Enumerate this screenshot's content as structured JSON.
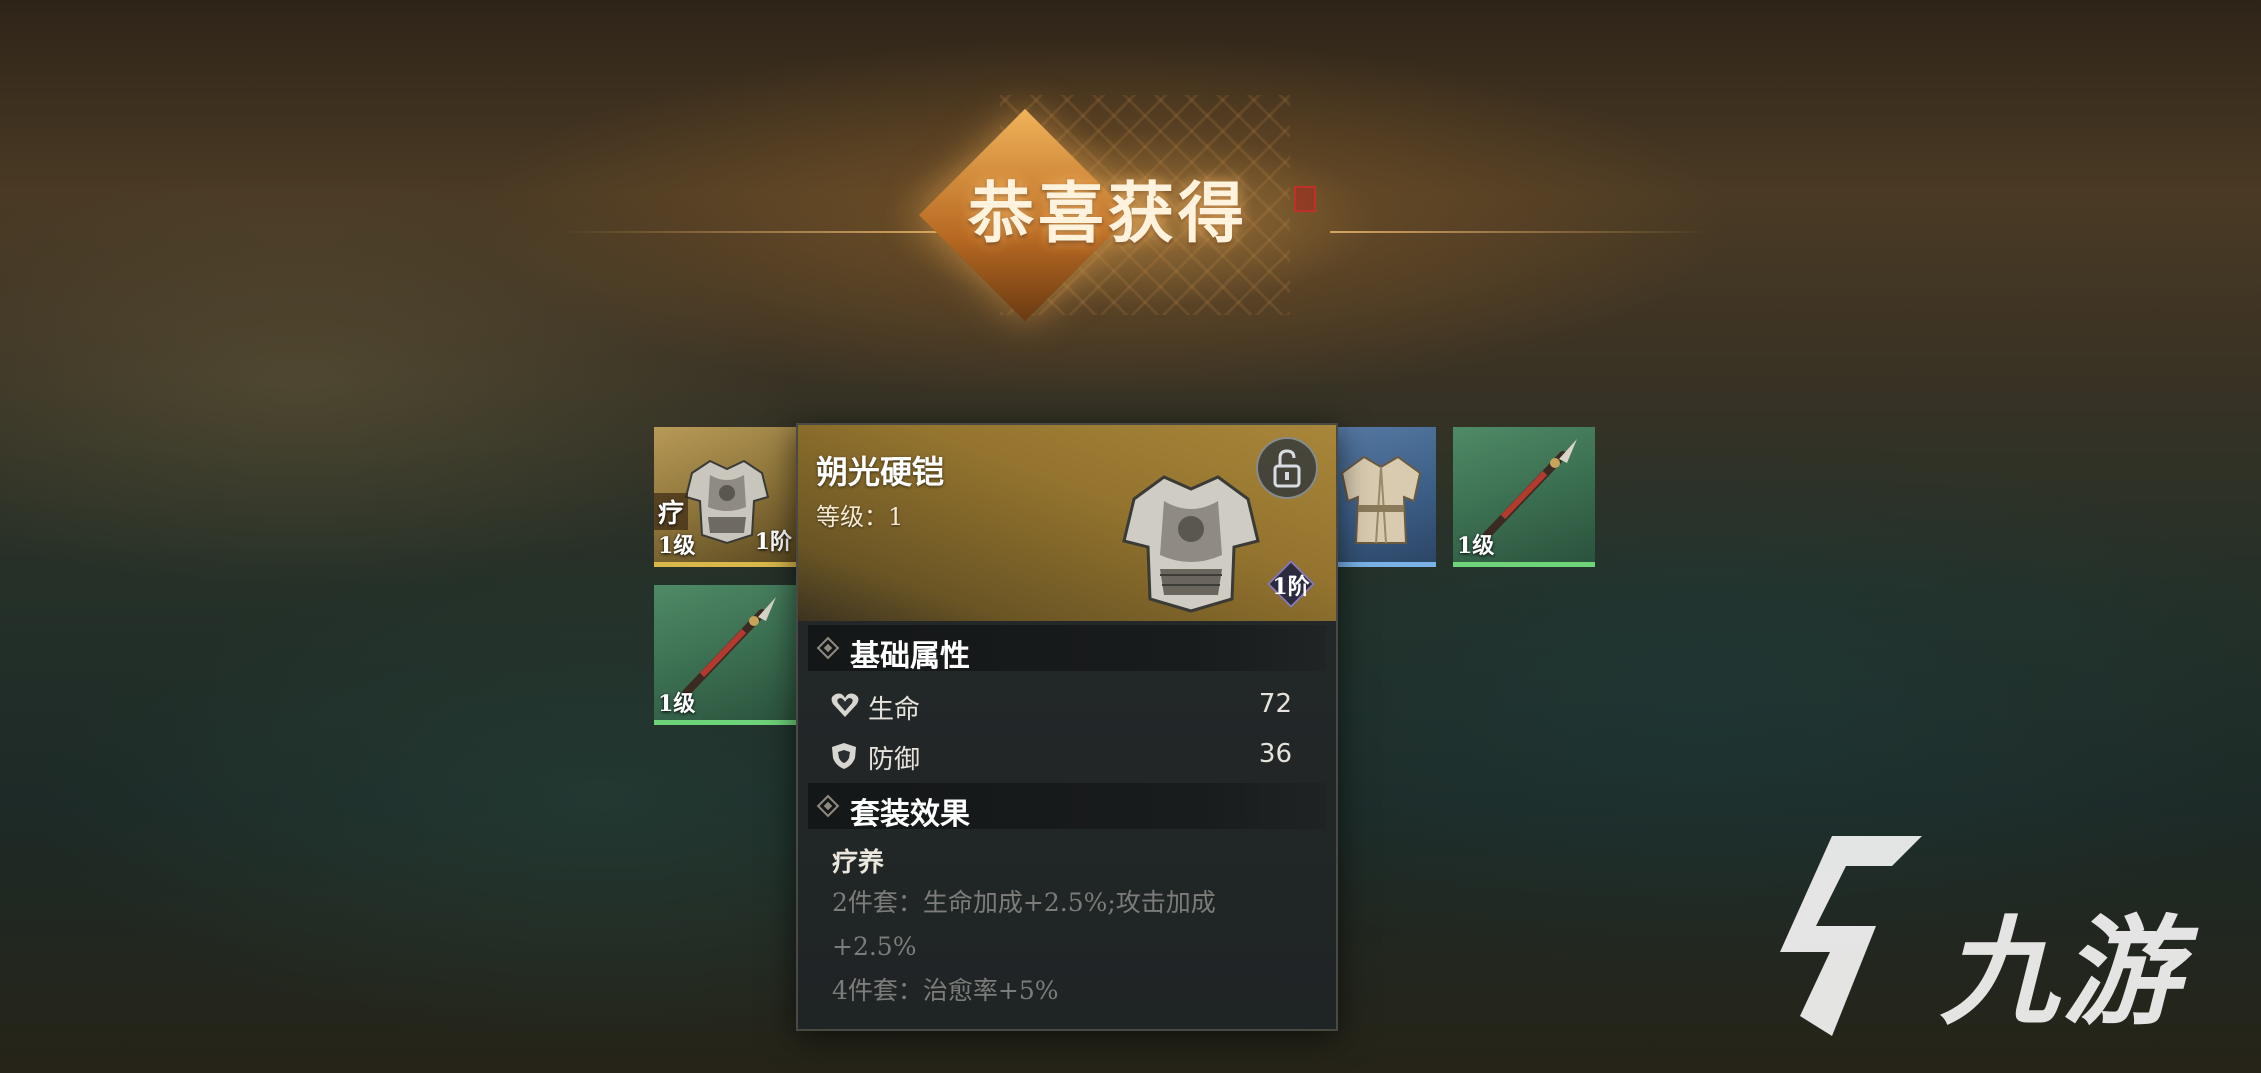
{
  "banner": {
    "title": "恭喜获得"
  },
  "items": [
    {
      "level": "1级",
      "tier": "1阶",
      "set_tag": "疗",
      "rarity": "gold",
      "icon": "armor-icon"
    },
    {
      "level": "",
      "rarity": "blue",
      "icon": "robe-icon"
    },
    {
      "level": "1级",
      "rarity": "green",
      "icon": "spear-icon"
    },
    {
      "level": "1级",
      "rarity": "green",
      "icon": "spear-icon"
    }
  ],
  "tooltip": {
    "name": "朔光硬铠",
    "level": "等级：1",
    "tier": "1阶",
    "lock_icon": "unlock-icon",
    "base_section_title": "基础属性",
    "stats": [
      {
        "icon": "heart-icon",
        "label": "生命",
        "value": "72"
      },
      {
        "icon": "shield-icon",
        "label": "防御",
        "value": "36"
      }
    ],
    "set_section_title": "套装效果",
    "set_name": "疗养",
    "set_lines": [
      "2件套：生命加成+2.5%;攻击加成",
      "+2.5%",
      "4件套：治愈率+5%"
    ]
  },
  "watermark": {
    "text": "九游",
    "logo_icon": "jiuyou-logo-icon"
  }
}
